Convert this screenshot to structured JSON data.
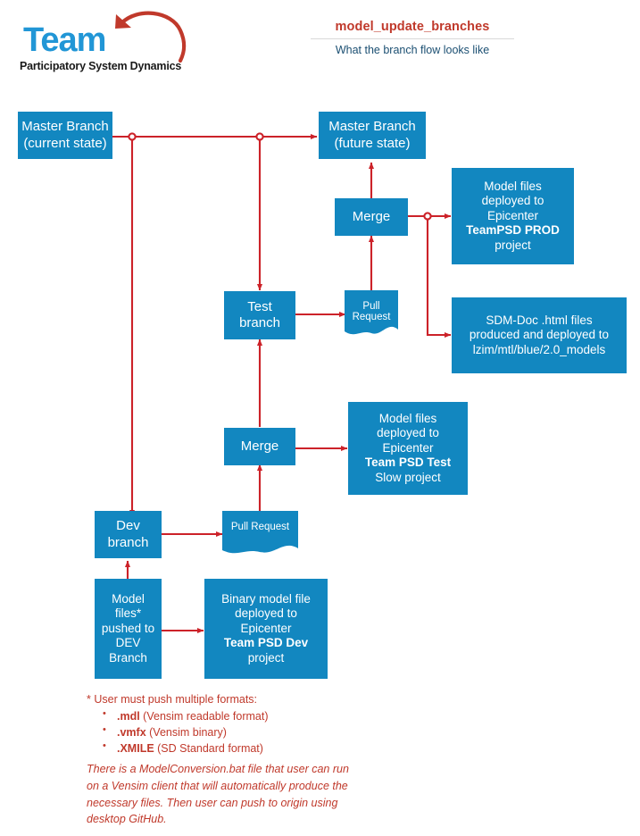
{
  "logo": {
    "wordmark": "Team",
    "tagline": "Participatory System Dynamics",
    "arrow_icon": "curved-arrow-icon",
    "wordmark_color": "#2196d6",
    "arrow_color": "#c0392b"
  },
  "header": {
    "title": "model_update_branches",
    "subtitle": "What the branch flow looks like",
    "title_color": "#c0392b",
    "subtitle_color": "#1b4f72"
  },
  "theme": {
    "node_fill": "#1287c0",
    "connector": "#cc2229",
    "node_text": "#ffffff"
  },
  "diagram": {
    "nodes": [
      {
        "id": "master-current",
        "label": "Master Branch\n(current state)",
        "lines": [
          "Master Branch",
          "(current state)"
        ]
      },
      {
        "id": "master-future",
        "label": "Master Branch\n(future state)",
        "lines": [
          "Master Branch",
          "(future state)"
        ]
      },
      {
        "id": "merge-prod",
        "label": "Merge",
        "lines": [
          "Merge"
        ]
      },
      {
        "id": "deploy-prod",
        "label": "Model files deployed to Epicenter TeamPSD PROD project",
        "lines": [
          "Model files",
          "deployed to",
          "Epicenter",
          "TeamPSD PROD",
          "project"
        ],
        "bold_line": "TeamPSD PROD"
      },
      {
        "id": "sdm-doc",
        "label": "SDM-Doc .html files produced and deployed to lzim/mtl/blue/2.0_models",
        "lines": [
          "SDM-Doc .html files",
          "produced and deployed to",
          "lzim/mtl/blue/2.0_models"
        ]
      },
      {
        "id": "test-branch",
        "label": "Test branch",
        "lines": [
          "Test",
          "branch"
        ]
      },
      {
        "id": "pull-request-test",
        "label": "Pull Request",
        "lines": [
          "Pull Request"
        ]
      },
      {
        "id": "merge-test",
        "label": "Merge",
        "lines": [
          "Merge"
        ]
      },
      {
        "id": "deploy-test",
        "label": "Model files deployed to Epicenter Team PSD Test Slow project",
        "lines": [
          "Model files",
          "deployed to",
          "Epicenter",
          "Team PSD Test",
          "Slow project"
        ],
        "bold_line": "Team PSD Test"
      },
      {
        "id": "dev-branch",
        "label": "Dev branch",
        "lines": [
          "Dev",
          "branch"
        ]
      },
      {
        "id": "pull-request-dev",
        "label": "Pull Request",
        "lines": [
          "Pull Request"
        ]
      },
      {
        "id": "model-files-push",
        "label": "Model files* pushed to DEV Branch",
        "lines": [
          "Model",
          "files*",
          "pushed to",
          "DEV",
          "Branch"
        ]
      },
      {
        "id": "deploy-dev",
        "label": "Binary model file deployed to Epicenter Team PSD Dev project",
        "lines": [
          "Binary model file",
          "deployed to",
          "Epicenter",
          "Team PSD Dev",
          "project"
        ],
        "bold_line": "Team PSD Dev"
      }
    ],
    "node_text": {
      "master_current_l1": "Master Branch",
      "master_current_l2": "(current state)",
      "master_future_l1": "Master Branch",
      "master_future_l2": "(future state)",
      "merge_prod": "Merge",
      "merge_test": "Merge",
      "deploy_prod_l1": "Model files",
      "deploy_prod_l2": "deployed to",
      "deploy_prod_l3": "Epicenter",
      "deploy_prod_l4": "TeamPSD PROD",
      "deploy_prod_l5": "project",
      "sdm_doc_l1": "SDM-Doc .html files",
      "sdm_doc_l2": "produced and deployed to",
      "sdm_doc_l3": "lzim/mtl/blue/2.0_models",
      "test_branch_l1": "Test",
      "test_branch_l2": "branch",
      "pull_request_test": "Pull Request",
      "pull_request_dev": "Pull Request",
      "deploy_test_l1": "Model files",
      "deploy_test_l2": "deployed to",
      "deploy_test_l3": "Epicenter",
      "deploy_test_l4": "Team PSD Test",
      "deploy_test_l5": "Slow project",
      "dev_branch_l1": "Dev",
      "dev_branch_l2": "branch",
      "model_push_l1": "Model",
      "model_push_l2": "files*",
      "model_push_l3": "pushed to",
      "model_push_l4": "DEV",
      "model_push_l5": "Branch",
      "deploy_dev_l1": "Binary model file",
      "deploy_dev_l2": "deployed to",
      "deploy_dev_l3": "Epicenter",
      "deploy_dev_l4": "Team PSD Dev",
      "deploy_dev_l5": "project"
    }
  },
  "footnotes": {
    "lead": "* User must push multiple formats:",
    "items": [
      {
        "name": ".mdl",
        "desc": " (Vensim readable format)"
      },
      {
        "name": ".vmfx",
        "desc": " (Vensim binary)"
      },
      {
        "name": ".XMILE",
        "desc": " (SD Standard format)"
      }
    ],
    "note": "There is a ModelConversion.bat file that user can run on a Vensim client that will automatically produce the necessary files.  Then user can push to origin using desktop GitHub."
  }
}
